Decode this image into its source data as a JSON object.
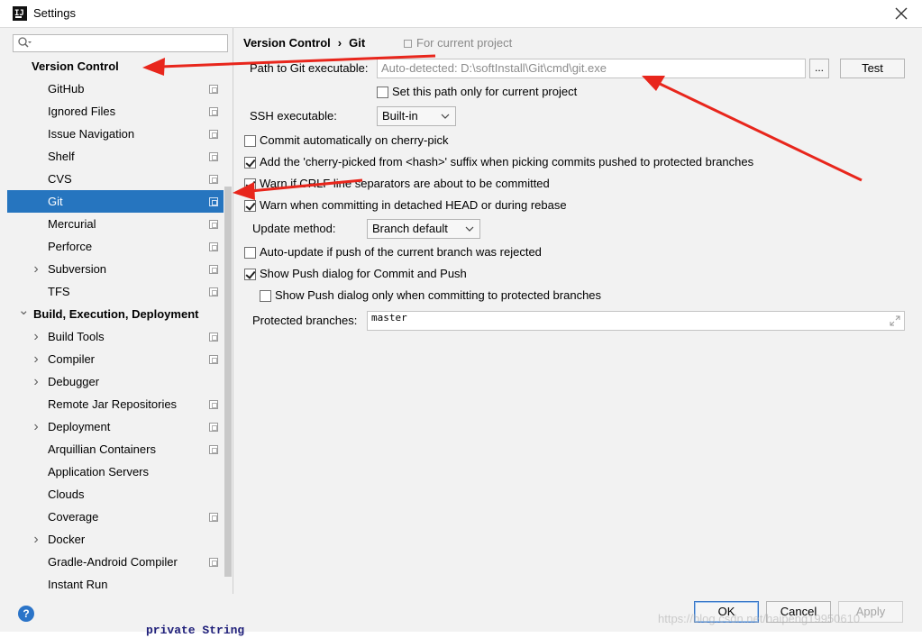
{
  "window": {
    "title": "Settings"
  },
  "search": {
    "value": ""
  },
  "tree": {
    "items": [
      {
        "label": "Version Control",
        "level": 0,
        "bold": true,
        "arrow": "",
        "project_icon": false,
        "selected": false
      },
      {
        "label": "GitHub",
        "level": 1,
        "bold": false,
        "arrow": "",
        "project_icon": true,
        "selected": false
      },
      {
        "label": "Ignored Files",
        "level": 1,
        "bold": false,
        "arrow": "",
        "project_icon": true,
        "selected": false
      },
      {
        "label": "Issue Navigation",
        "level": 1,
        "bold": false,
        "arrow": "",
        "project_icon": true,
        "selected": false
      },
      {
        "label": "Shelf",
        "level": 1,
        "bold": false,
        "arrow": "",
        "project_icon": true,
        "selected": false
      },
      {
        "label": "CVS",
        "level": 1,
        "bold": false,
        "arrow": "",
        "project_icon": true,
        "selected": false
      },
      {
        "label": "Git",
        "level": 1,
        "bold": false,
        "arrow": "",
        "project_icon": true,
        "selected": true
      },
      {
        "label": "Mercurial",
        "level": 1,
        "bold": false,
        "arrow": "",
        "project_icon": true,
        "selected": false
      },
      {
        "label": "Perforce",
        "level": 1,
        "bold": false,
        "arrow": "",
        "project_icon": true,
        "selected": false
      },
      {
        "label": "Subversion",
        "level": 1,
        "bold": false,
        "arrow": "right",
        "project_icon": true,
        "selected": false
      },
      {
        "label": "TFS",
        "level": 1,
        "bold": false,
        "arrow": "",
        "project_icon": true,
        "selected": false
      },
      {
        "label": "Build, Execution, Deployment",
        "level": 0,
        "bold": true,
        "arrow": "down",
        "project_icon": false,
        "selected": false
      },
      {
        "label": "Build Tools",
        "level": 1,
        "bold": false,
        "arrow": "right",
        "project_icon": true,
        "selected": false
      },
      {
        "label": "Compiler",
        "level": 1,
        "bold": false,
        "arrow": "right",
        "project_icon": true,
        "selected": false
      },
      {
        "label": "Debugger",
        "level": 1,
        "bold": false,
        "arrow": "right",
        "project_icon": false,
        "selected": false
      },
      {
        "label": "Remote Jar Repositories",
        "level": 1,
        "bold": false,
        "arrow": "",
        "project_icon": true,
        "selected": false
      },
      {
        "label": "Deployment",
        "level": 1,
        "bold": false,
        "arrow": "right",
        "project_icon": true,
        "selected": false
      },
      {
        "label": "Arquillian Containers",
        "level": 1,
        "bold": false,
        "arrow": "",
        "project_icon": true,
        "selected": false
      },
      {
        "label": "Application Servers",
        "level": 1,
        "bold": false,
        "arrow": "",
        "project_icon": false,
        "selected": false
      },
      {
        "label": "Clouds",
        "level": 1,
        "bold": false,
        "arrow": "",
        "project_icon": false,
        "selected": false
      },
      {
        "label": "Coverage",
        "level": 1,
        "bold": false,
        "arrow": "",
        "project_icon": true,
        "selected": false
      },
      {
        "label": "Docker",
        "level": 1,
        "bold": false,
        "arrow": "right",
        "project_icon": false,
        "selected": false
      },
      {
        "label": "Gradle-Android Compiler",
        "level": 1,
        "bold": false,
        "arrow": "",
        "project_icon": true,
        "selected": false
      },
      {
        "label": "Instant Run",
        "level": 1,
        "bold": false,
        "arrow": "",
        "project_icon": false,
        "selected": false
      }
    ]
  },
  "breadcrumb": {
    "parent": "Version Control",
    "separator": "›",
    "current": "Git",
    "scope": "For current project"
  },
  "git": {
    "path_label": "Path to Git executable:",
    "path_value": "Auto-detected: D:\\softInstall\\Git\\cmd\\git.exe",
    "browse_label": "...",
    "test_label": "Test",
    "set_path_only_label": "Set this path only for current project",
    "set_path_only_checked": false,
    "ssh_label": "SSH executable:",
    "ssh_value": "Built-in",
    "options": [
      {
        "label": "Commit automatically on cherry-pick",
        "checked": false
      },
      {
        "label": "Add the 'cherry-picked from <hash>' suffix when picking commits pushed to protected branches",
        "checked": true
      },
      {
        "label": "Warn if CRLF line separators are about to be committed",
        "checked": true
      },
      {
        "label": "Warn when committing in detached HEAD or during rebase",
        "checked": true
      }
    ],
    "update_method_label": "Update method:",
    "update_method_value": "Branch default",
    "auto_update_label": "Auto-update if push of the current branch was rejected",
    "auto_update_checked": false,
    "show_push_label": "Show Push dialog for Commit and Push",
    "show_push_checked": true,
    "show_push_protected_label": "Show Push dialog only when committing to protected branches",
    "show_push_protected_checked": false,
    "protected_label": "Protected branches:",
    "protected_value": "master"
  },
  "buttons": {
    "help": "?",
    "ok": "OK",
    "cancel": "Cancel",
    "apply": "Apply"
  },
  "watermark": "https://blog.csdn.net/haipeng19950610",
  "background_code": "private String",
  "colors": {
    "selection": "#2675bf",
    "annotation_arrow": "#e8261c"
  }
}
